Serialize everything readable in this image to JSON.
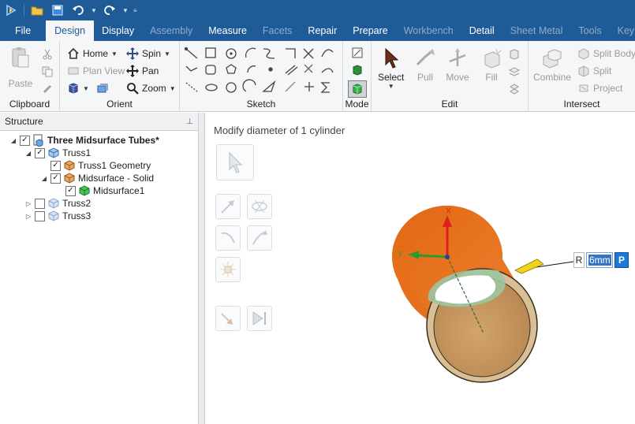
{
  "qat": {
    "icons": [
      "app-logo-icon",
      "open-folder-icon",
      "save-icon",
      "undo-icon",
      "redo-icon",
      "customize-icon"
    ]
  },
  "tabs": [
    {
      "label": "File",
      "state": "normal"
    },
    {
      "label": "Design",
      "state": "active"
    },
    {
      "label": "Display",
      "state": "normal"
    },
    {
      "label": "Assembly",
      "state": "disabled"
    },
    {
      "label": "Measure",
      "state": "normal"
    },
    {
      "label": "Facets",
      "state": "disabled"
    },
    {
      "label": "Repair",
      "state": "normal"
    },
    {
      "label": "Prepare",
      "state": "normal"
    },
    {
      "label": "Workbench",
      "state": "disabled"
    },
    {
      "label": "Detail",
      "state": "normal"
    },
    {
      "label": "Sheet Metal",
      "state": "disabled"
    },
    {
      "label": "Tools",
      "state": "disabled"
    },
    {
      "label": "KeySho",
      "state": "disabled"
    }
  ],
  "ribbon": {
    "clipboard": {
      "label": "Clipboard",
      "paste": "Paste"
    },
    "orient": {
      "label": "Orient",
      "home": "Home",
      "spin": "Spin",
      "plan_view": "Plan View",
      "pan": "Pan",
      "zoom": "Zoom"
    },
    "sketch": {
      "label": "Sketch"
    },
    "mode": {
      "label": "Mode"
    },
    "edit": {
      "label": "Edit",
      "select": "Select",
      "pull": "Pull",
      "move": "Move",
      "fill": "Fill"
    },
    "intersect": {
      "label": "Intersect",
      "combine": "Combine",
      "split_body": "Split Body",
      "split": "Split",
      "project": "Project"
    }
  },
  "structure": {
    "title": "Structure",
    "pin": "⊥",
    "items": [
      {
        "label": "Three Midsurface Tubes*",
        "checked": true
      },
      {
        "label": "Truss1",
        "checked": true
      },
      {
        "label": "Truss1 Geometry",
        "checked": true
      },
      {
        "label": "Midsurface - Solid",
        "checked": true
      },
      {
        "label": "Midsurface1",
        "checked": true
      },
      {
        "label": "Truss2",
        "checked": false
      },
      {
        "label": "Truss3",
        "checked": false
      }
    ]
  },
  "viewport": {
    "hint": "Modify diameter of 1 cylinder",
    "axis_x": "X",
    "axis_y": "Y",
    "dimension": {
      "prefix": "R",
      "value": "6mm",
      "lock_button": "P"
    }
  },
  "colors": {
    "title_bar": "#1e5b97",
    "ribbon_bg": "#f5f6f7",
    "cylinder_outer": "#e8711e",
    "cylinder_inner": "#c99a60",
    "axis_x": "#e02020",
    "axis_y": "#2e9a2e",
    "selection": "#3574c4"
  }
}
